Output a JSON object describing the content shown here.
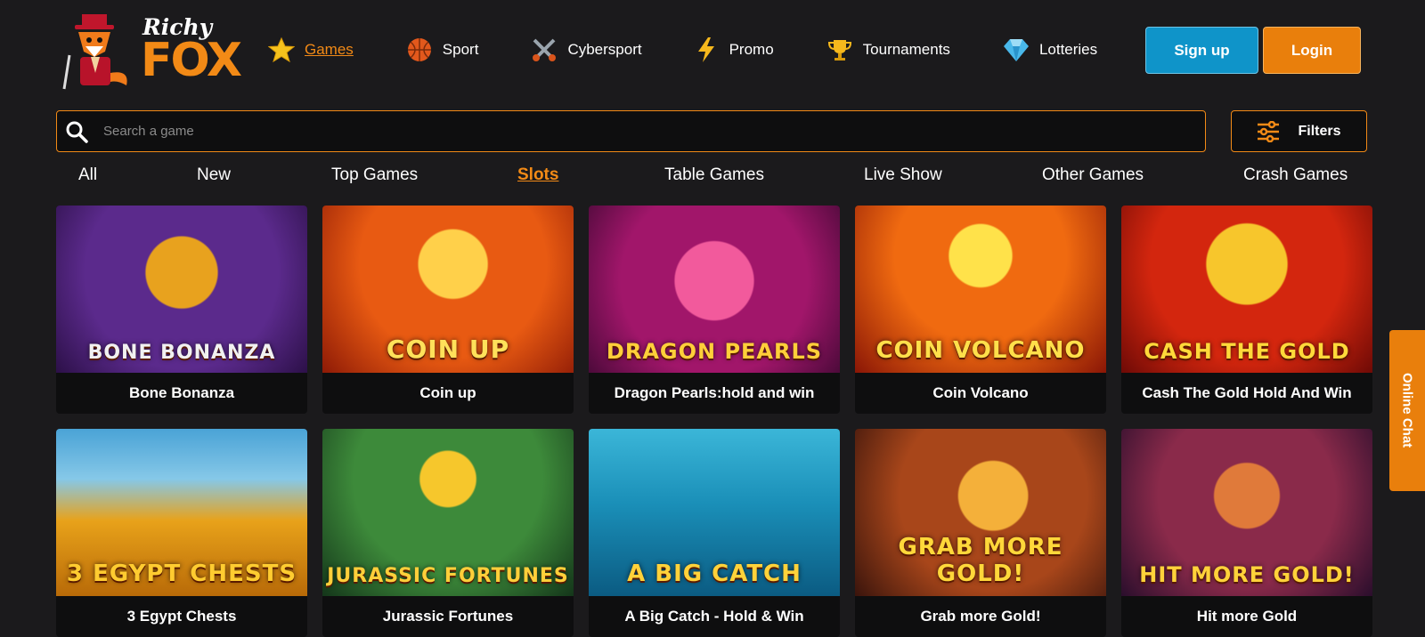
{
  "brand": {
    "line1": "Richy",
    "line2": "FOX"
  },
  "nav": [
    {
      "label": "Games",
      "icon": "star-icon",
      "active": true
    },
    {
      "label": "Sport",
      "icon": "basketball-icon"
    },
    {
      "label": "Cybersport",
      "icon": "crossed-swords-icon"
    },
    {
      "label": "Promo",
      "icon": "lightning-icon"
    },
    {
      "label": "Tournaments",
      "icon": "trophy-icon"
    },
    {
      "label": "Lotteries",
      "icon": "diamond-icon"
    }
  ],
  "auth": {
    "signup": "Sign up",
    "login": "Login"
  },
  "search": {
    "placeholder": "Search a game"
  },
  "filters": {
    "label": "Filters"
  },
  "tabs": [
    {
      "label": "All"
    },
    {
      "label": "New"
    },
    {
      "label": "Top Games"
    },
    {
      "label": "Slots",
      "active": true
    },
    {
      "label": "Table Games"
    },
    {
      "label": "Live Show"
    },
    {
      "label": "Other Games"
    },
    {
      "label": "Crash Games"
    }
  ],
  "games": [
    {
      "name": "Bone Bonanza",
      "art": "BONE BONANZA"
    },
    {
      "name": "Coin up",
      "art": "COIN UP"
    },
    {
      "name": "Dragon Pearls:hold and win",
      "art": "DRAGON PEARLS"
    },
    {
      "name": "Coin Volcano",
      "art": "COIN VOLCANO"
    },
    {
      "name": "Cash The Gold Hold And Win",
      "art": "CASH THE GOLD"
    },
    {
      "name": "3 Egypt Chests",
      "art": "3 EGYPT CHESTS"
    },
    {
      "name": "Jurassic Fortunes",
      "art": "JURASSIC FORTUNES"
    },
    {
      "name": "A Big Catch - Hold & Win",
      "art": "A BIG CATCH"
    },
    {
      "name": "Grab more Gold!",
      "art": "GRAB MORE GOLD!"
    },
    {
      "name": "Hit more Gold",
      "art": "HIT MORE GOLD!"
    }
  ],
  "chat": {
    "label": "Online Chat"
  },
  "colors": {
    "accent": "#f28a16",
    "signup": "#0f94c9",
    "background": "#1b1a1c"
  }
}
